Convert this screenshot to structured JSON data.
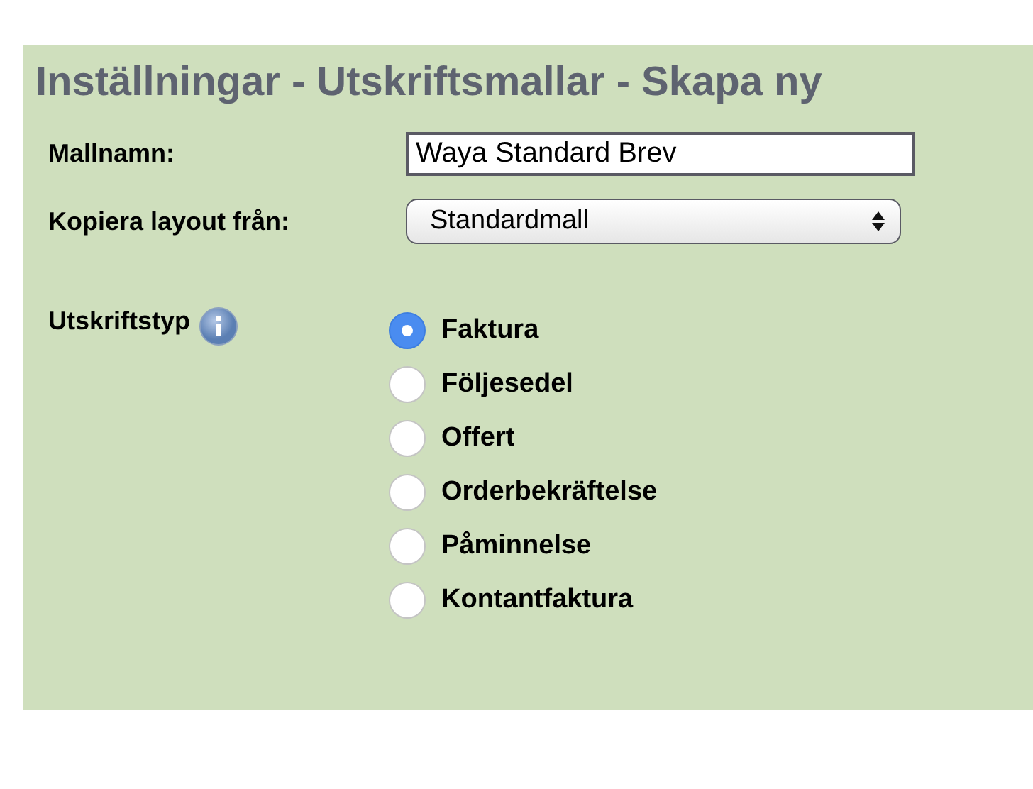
{
  "title": "Inställningar - Utskriftsmallar - Skapa ny",
  "template_name": {
    "label": "Mallnamn:",
    "value": "Waya Standard Brev"
  },
  "copy_layout": {
    "label": "Kopiera layout från:",
    "value": "Standardmall"
  },
  "print_type": {
    "label": "Utskriftstyp",
    "options": [
      {
        "label": "Faktura",
        "selected": true
      },
      {
        "label": "Följesedel",
        "selected": false
      },
      {
        "label": "Offert",
        "selected": false
      },
      {
        "label": "Orderbekräftelse",
        "selected": false
      },
      {
        "label": "Påminnelse",
        "selected": false
      },
      {
        "label": "Kontantfaktura",
        "selected": false
      }
    ]
  }
}
